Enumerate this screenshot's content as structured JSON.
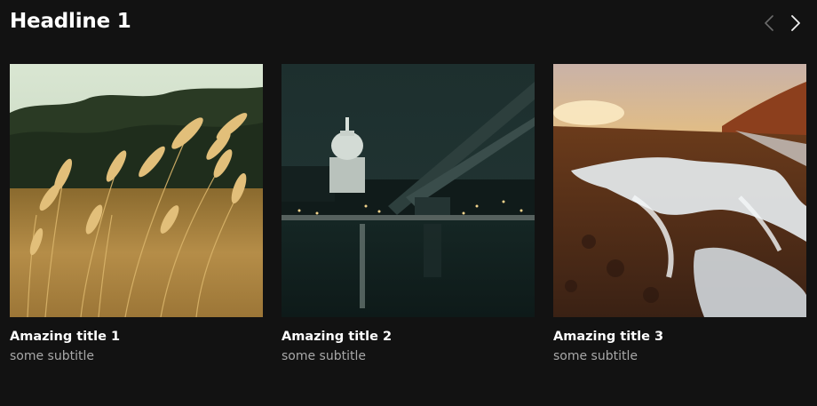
{
  "header": {
    "title": "Headline 1"
  },
  "nav": {
    "prev_icon": "chevron-left-icon",
    "next_icon": "chevron-right-icon"
  },
  "cards": [
    {
      "title": "Amazing title 1",
      "subtitle": "some subtitle",
      "image": "wheat-field-photo"
    },
    {
      "title": "Amazing title 2",
      "subtitle": "some subtitle",
      "image": "night-city-bridge-photo"
    },
    {
      "title": "Amazing title 3",
      "subtitle": "some subtitle",
      "image": "sunset-winter-road-photo"
    }
  ],
  "colors": {
    "background": "#121212",
    "title": "#ffffff",
    "subtitle": "#a8a8a8"
  }
}
